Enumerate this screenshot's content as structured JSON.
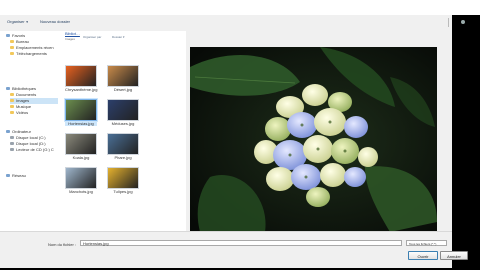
{
  "toolbar": {
    "organize_label": "Organiser",
    "new_folder_label": "Nouveau dossier"
  },
  "nav": {
    "favorites": [
      "Favoris",
      "Bureau",
      "Emplacements récen",
      "Téléchargements"
    ],
    "libraries": [
      "Bibliothèques",
      "Documents",
      "Images",
      "Musique",
      "Vidéos"
    ],
    "computer": [
      "Ordinateur",
      "Disque local (C:)",
      "Disque local (D:)",
      "Lecteur de CD (G:) C"
    ],
    "network": [
      "Réseau"
    ]
  },
  "content": {
    "breadcrumb": "Bibliot…",
    "breadcrumb_sub": "Images",
    "arrange_label": "Organiser par",
    "sort_label": "Dossier ▾",
    "files": [
      {
        "name": "Chrysanthème.jpg",
        "color": "#e8611f"
      },
      {
        "name": "Désert.jpg",
        "color": "#c98b4a"
      },
      {
        "name": "Hortensias.jpg",
        "color": "#6b8e4e"
      },
      {
        "name": "Méduses.jpg",
        "color": "#2c3f6b"
      },
      {
        "name": "Koala.jpg",
        "color": "#8b8a7c"
      },
      {
        "name": "Phare.jpg",
        "color": "#4a6f96"
      },
      {
        "name": "Manchots.jpg",
        "color": "#9fb6cc"
      },
      {
        "name": "Tulipes.jpg",
        "color": "#e6b22e"
      }
    ],
    "selected_index": 2
  },
  "preview": {
    "colors": {
      "leaf": "#2f5a2a",
      "petal_blue": "#8fa4e6",
      "petal_cream": "#f0f0c4",
      "petal_green": "#cfe09a"
    }
  },
  "footer": {
    "filename_label": "Nom du fichier :",
    "filename_value": "Hortensias.jpg",
    "filetype_value": "Tous les fichiers (*.*)",
    "open_label": "Ouvrir",
    "cancel_label": "Annuler"
  }
}
